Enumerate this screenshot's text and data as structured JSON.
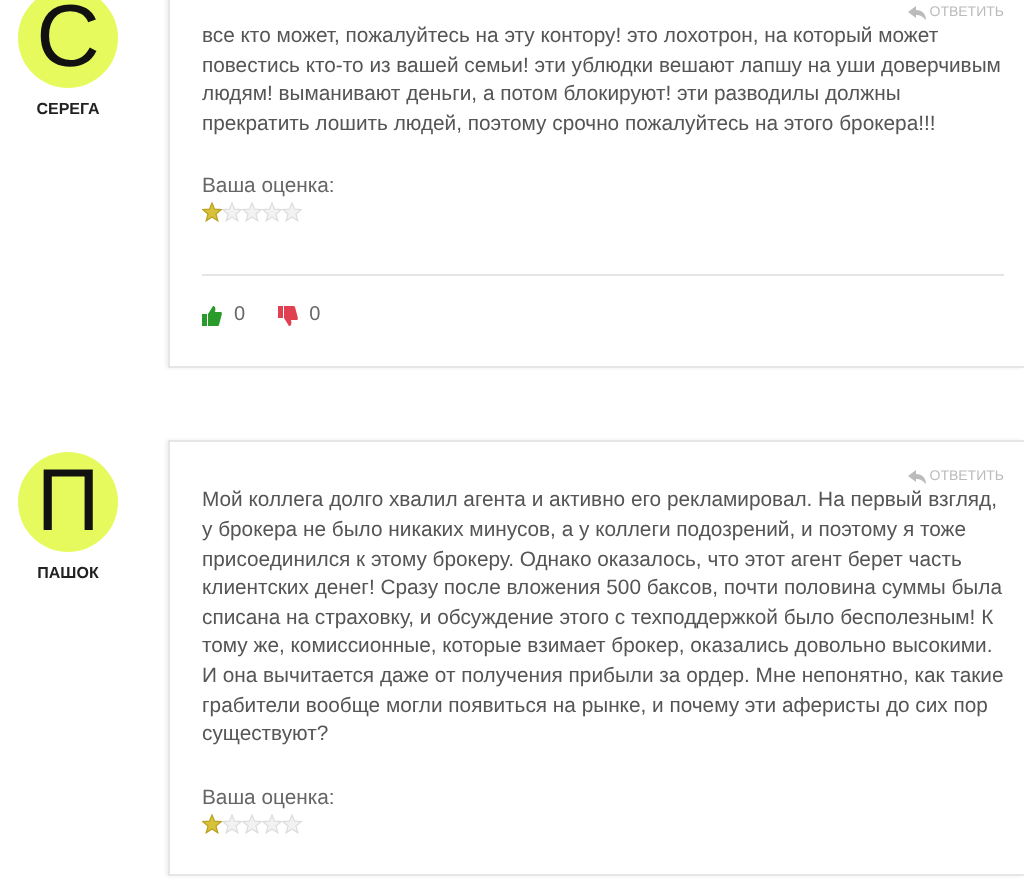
{
  "comments": [
    {
      "avatar_letter": "С",
      "author": "СЕРЕГА",
      "reply": "ОТВЕТИТЬ",
      "text": "все кто может, пожалуйтесь на эту контору! это лохотрон, на который может повестись кто-то из вашей семьи! эти ублюдки вешают лапшу на уши доверчивым людям! выманивают деньги, а потом блокируют! эти разводилы должны прекратить лошить людей, поэтому срочно пожалуйтесь на этого брокера!!!",
      "rating_label": "Ваша оценка:",
      "stars": 1,
      "likes": "0",
      "dislikes": "0"
    },
    {
      "avatar_letter": "П",
      "author": "ПАШОК",
      "reply": "ОТВЕТИТЬ",
      "text": "Мой коллега долго хвалил агента и активно его рекламировал. На первый взгляд, у брокера не было никаких минусов, а у коллеги подозрений, и поэтому я тоже присоединился к этому брокеру. Однако оказалось, что этот агент берет часть клиентских денег! Сразу после вложения 500 баксов, почти половина суммы была списана на страховку, и обсуждение этого с техподдержкой было бесполезным! К тому же, комиссионные, которые взимает брокер, оказались довольно высокими. И она вычитается даже от получения прибыли за ордер. Мне непонятно, как такие грабители вообще могли появиться на рынке, и почему эти аферисты до сих пор существуют?",
      "rating_label": "Ваша оценка:",
      "stars": 1
    }
  ]
}
